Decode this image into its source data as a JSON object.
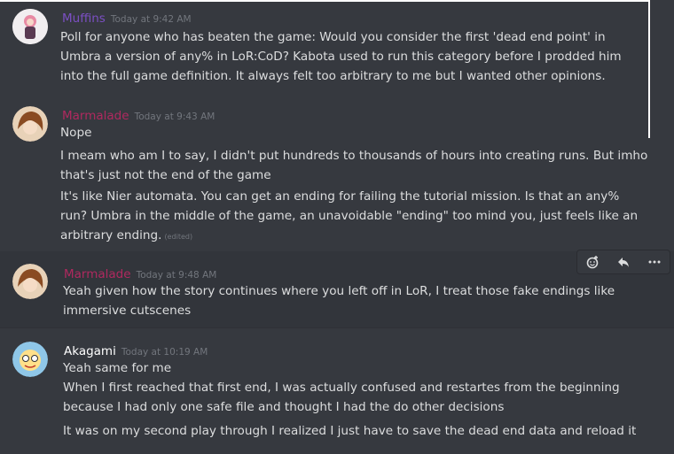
{
  "messages": [
    {
      "author": "Muffins",
      "author_color": "#7b4fc3",
      "timestamp": "Today at 9:42 AM",
      "lines": [
        "Poll for anyone who has beaten the game: Would you consider the first 'dead end point' in",
        "Umbra a version of any% in LoR:CoD? Kabota used to run this category before I prodded him",
        "into the full game definition. It always felt too arbitrary to me but I wanted other opinions."
      ]
    },
    {
      "author": "Marmalade",
      "author_color": "#b0295f",
      "timestamp": "Today at 9:43 AM",
      "line1": "Nope",
      "line2a": "I meam who am I to say, I didn't put hundreds to thousands of hours into creating runs. But imho",
      "line2b": "that's just not the end of the game",
      "line3a": "It's like Nier automata. You can get an ending for failing the tutorial mission. Is that an any%",
      "line3b": "run? Umbra in the middle of the game, an unavoidable \"ending\" too mind you, just feels like an",
      "line3c": "arbitrary ending.",
      "edited": "(edited)"
    },
    {
      "author": "Marmalade",
      "author_color": "#b0295f",
      "timestamp": "Today at 9:48 AM",
      "line1": "Yeah given how the story continues where you left off in LoR, I treat those fake endings like",
      "line2": "immersive cutscenes"
    },
    {
      "author": "Akagami",
      "author_color": "#ffffff",
      "timestamp": "Today at 10:19 AM",
      "line1": "Yeah same for me",
      "line2a": "When I first reached that first end, I was actually confused and restartes from the beginning",
      "line2b": "because I had only one safe file and thought I had the do other decisions",
      "line3": "It was on my second play through I realized I just have to save the dead end data and reload it"
    }
  ],
  "toolbar": {
    "icons": [
      "add-reaction-icon",
      "reply-icon",
      "more-options-icon"
    ]
  }
}
